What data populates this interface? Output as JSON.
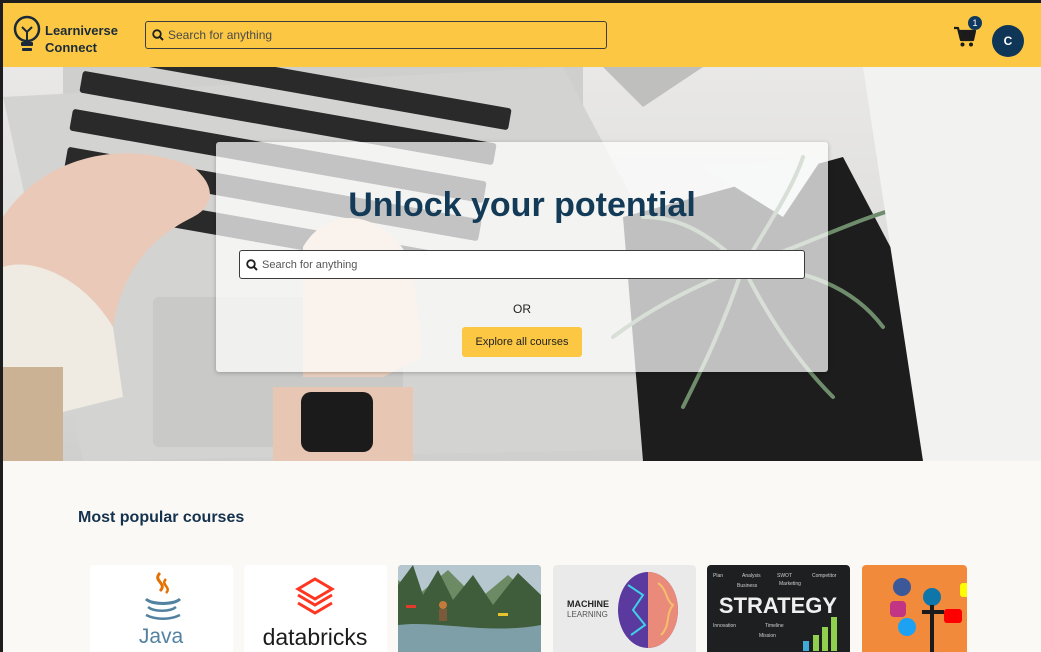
{
  "brand": {
    "line1": "Learniverse",
    "line2": "Connect"
  },
  "header": {
    "search_placeholder": "Search for anything",
    "cart_count": "1",
    "avatar_initial": "C"
  },
  "hero": {
    "title": "Unlock your potential",
    "search_placeholder": "Search for anything",
    "or_text": "OR",
    "explore_label": "Explore all courses"
  },
  "popular": {
    "title": "Most popular courses",
    "courses": [
      {
        "thumb": "java-logo",
        "text": "Java"
      },
      {
        "thumb": "databricks-logo",
        "text": "databricks"
      },
      {
        "thumb": "nature-photo",
        "text": ""
      },
      {
        "thumb": "machine-learning-brain",
        "text": "MACHINE LEARNING"
      },
      {
        "thumb": "strategy-chalkboard",
        "text": "STRATEGY"
      },
      {
        "thumb": "social-media-icons",
        "text": ""
      }
    ]
  },
  "colors": {
    "accent": "#fcc844",
    "navy": "#133a56",
    "background": "#fbf9f6"
  }
}
